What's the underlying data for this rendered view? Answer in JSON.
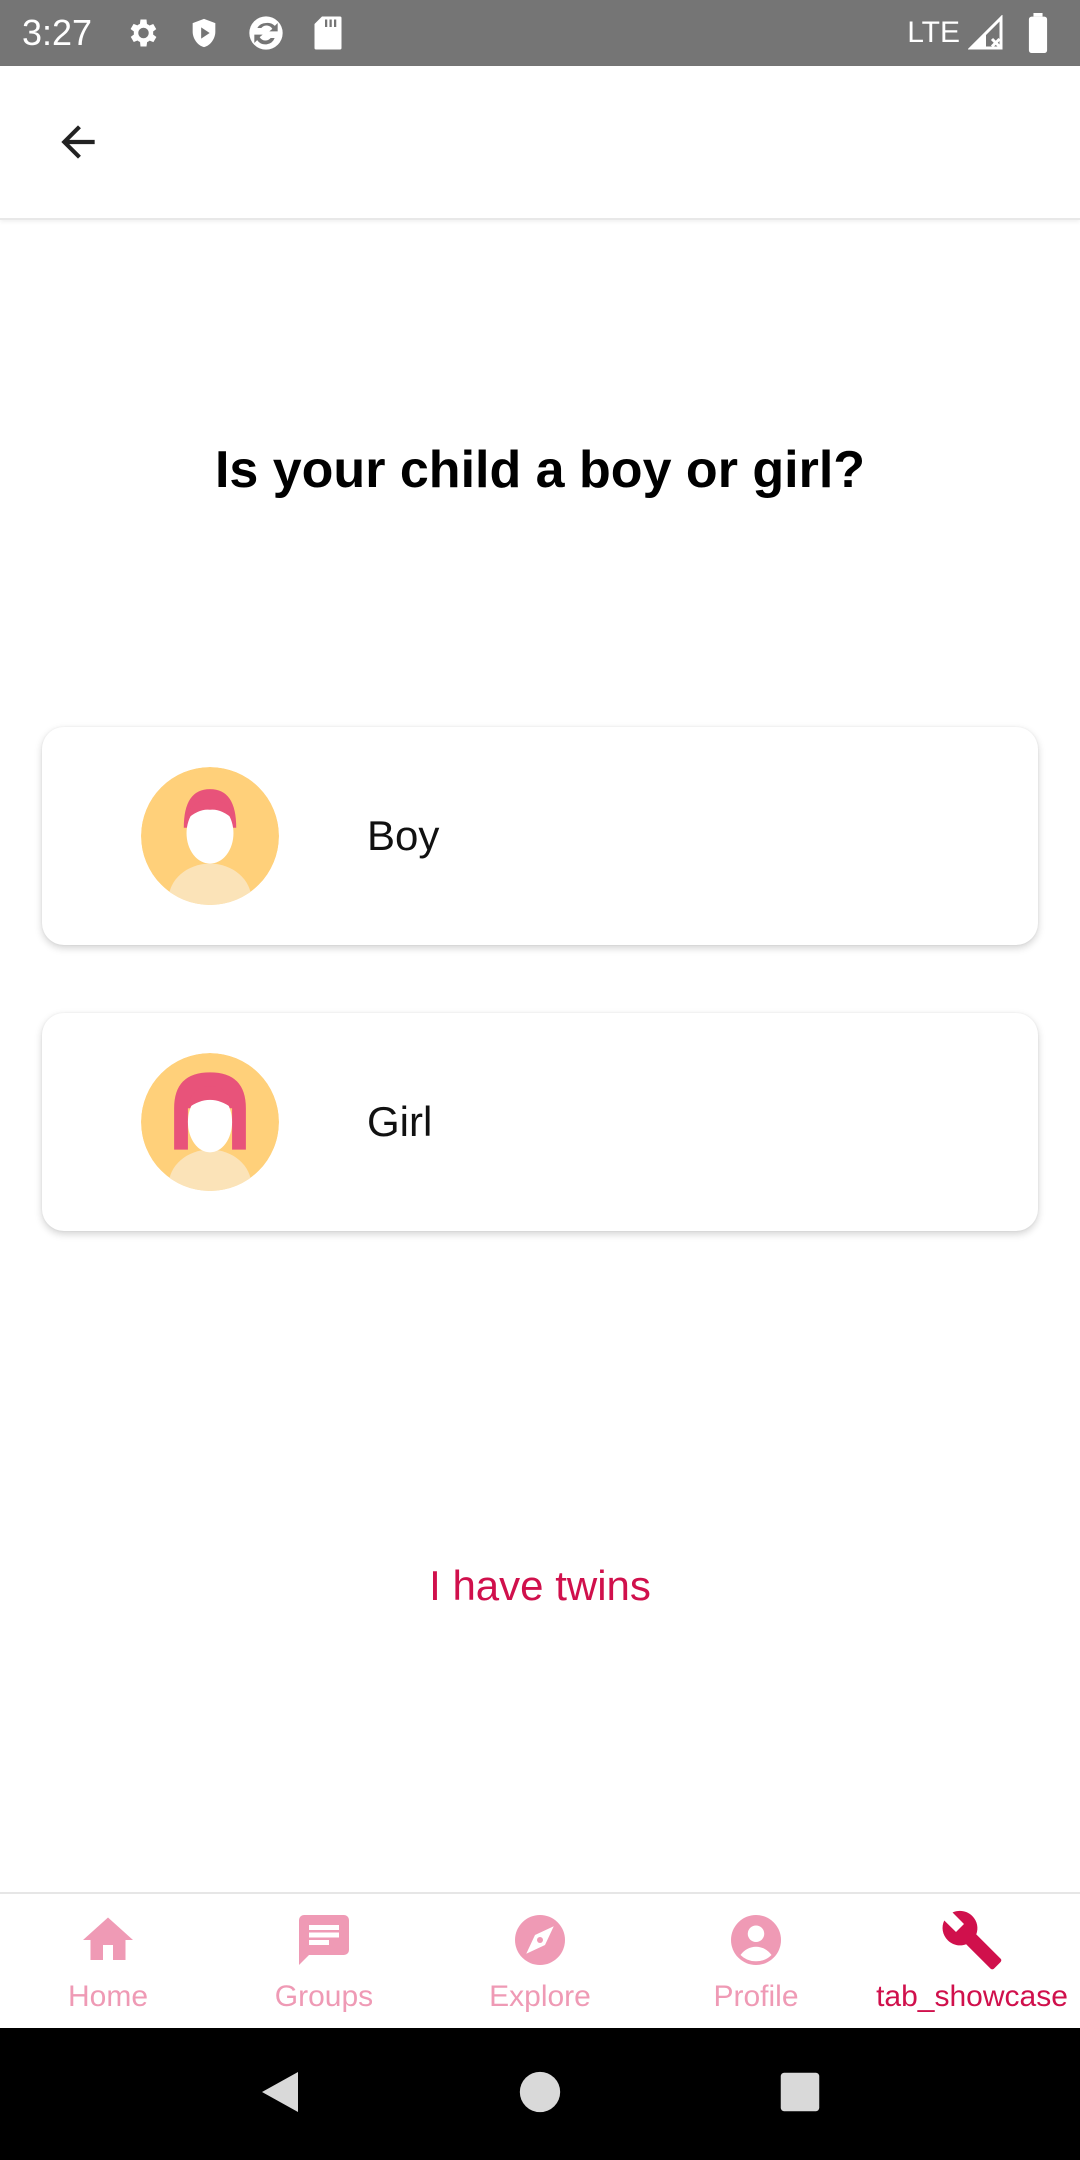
{
  "status_bar": {
    "time": "3:27",
    "network": "LTE",
    "icons": [
      "gear-icon",
      "shield-icon",
      "sync-icon",
      "sd-card-icon",
      "signal-icon",
      "battery-icon"
    ]
  },
  "app_bar": {
    "back_icon": "arrow-left-icon"
  },
  "question": {
    "title": "Is your child a boy or girl?"
  },
  "options": [
    {
      "label": "Boy",
      "icon": "boy-avatar-icon"
    },
    {
      "label": "Girl",
      "icon": "girl-avatar-icon"
    }
  ],
  "twins_link": {
    "label": "I have twins"
  },
  "bottom_nav": {
    "items": [
      {
        "label": "Home",
        "icon": "home-icon"
      },
      {
        "label": "Groups",
        "icon": "chat-icon"
      },
      {
        "label": "Explore",
        "icon": "compass-icon"
      },
      {
        "label": "Profile",
        "icon": "person-icon"
      },
      {
        "label": "tab_showcase",
        "icon": "wrench-icon"
      }
    ]
  },
  "colors": {
    "accent": "#d0104c",
    "nav_inactive": "#ef9ab5",
    "avatar_bg": "#ffd07a",
    "avatar_hair": "#e8537a",
    "status_bar": "#757575"
  }
}
